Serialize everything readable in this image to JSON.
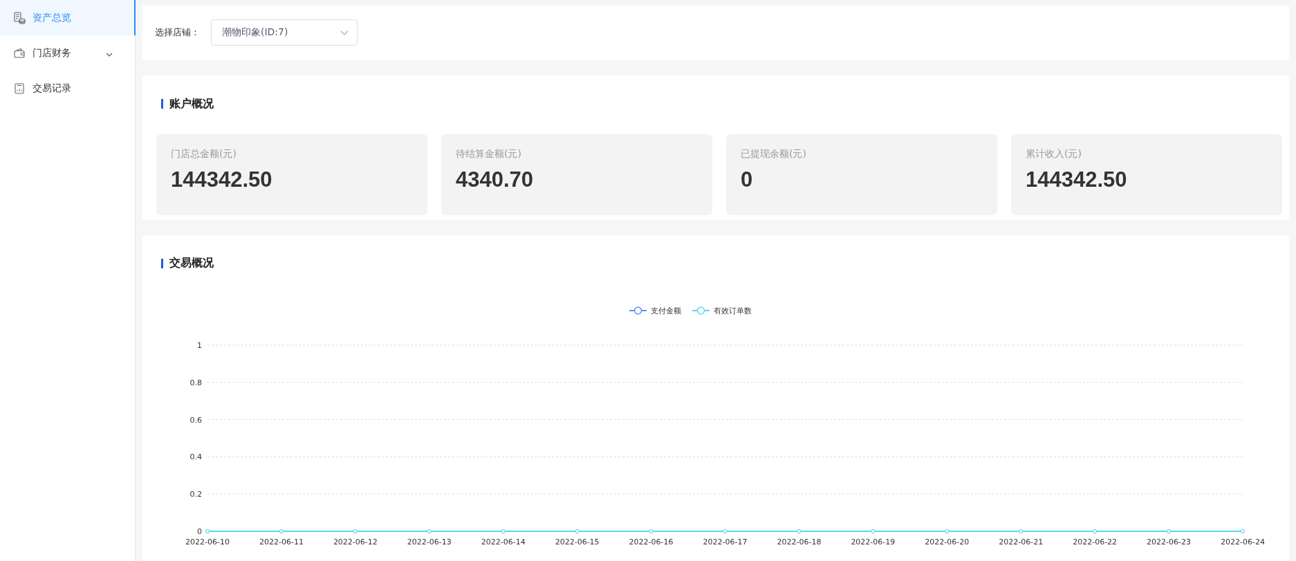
{
  "sidebar": {
    "items": [
      {
        "label": "资产总览",
        "selected": true,
        "expandable": false
      },
      {
        "label": "门店财务",
        "selected": false,
        "expandable": true
      },
      {
        "label": "交易记录",
        "selected": false,
        "expandable": false
      }
    ]
  },
  "store_filter": {
    "label": "选择店铺：",
    "value": "潮物印象(ID:7)"
  },
  "account_overview": {
    "title": "账户概况",
    "stats": [
      {
        "label": "门店总金额(元)",
        "value": "144342.50"
      },
      {
        "label": "待结算金额(元)",
        "value": "4340.70"
      },
      {
        "label": "已提现余额(元)",
        "value": "0"
      },
      {
        "label": "累计收入(元)",
        "value": "144342.50"
      }
    ]
  },
  "transaction_overview": {
    "title": "交易概况",
    "chart_data": {
      "type": "line",
      "x": [
        "2022-06-10",
        "2022-06-11",
        "2022-06-12",
        "2022-06-13",
        "2022-06-14",
        "2022-06-15",
        "2022-06-16",
        "2022-06-17",
        "2022-06-18",
        "2022-06-19",
        "2022-06-20",
        "2022-06-21",
        "2022-06-22",
        "2022-06-23",
        "2022-06-24"
      ],
      "series": [
        {
          "name": "支付金额",
          "color": "#5b8ff9",
          "marker": true,
          "values": [
            0,
            0,
            0,
            0,
            0,
            0,
            0,
            0,
            0,
            0,
            0,
            0,
            0,
            0,
            0
          ]
        },
        {
          "name": "有效订单数",
          "color": "#5ad8f5",
          "marker": true,
          "values": [
            0,
            0,
            0,
            0,
            0,
            0,
            0,
            0,
            0,
            0,
            0,
            0,
            0,
            0,
            0
          ]
        }
      ],
      "ylim": [
        0,
        1
      ],
      "yticks": [
        0,
        0.2,
        0.4,
        0.6,
        0.8,
        1
      ],
      "grid": true,
      "legend": true
    }
  }
}
